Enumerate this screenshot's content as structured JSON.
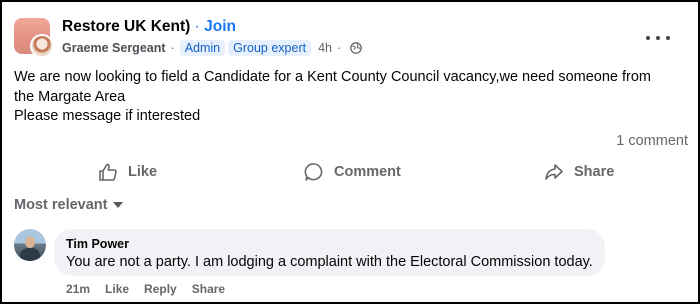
{
  "post": {
    "group_name": "Restore UK Kent)",
    "separator": "·",
    "join_label": "Join",
    "author": "Graeme Sergeant",
    "badges": [
      "Admin",
      "Group expert"
    ],
    "time": "4h",
    "time_separator": "·",
    "text_lines": [
      "We are now looking to field a Candidate for a Kent County Council vacancy,we need someone from",
      "the Margate Area",
      "Please message if interested"
    ],
    "comment_count": "1 comment"
  },
  "actions": {
    "like": "Like",
    "comment": "Comment",
    "share": "Share"
  },
  "sort_label": "Most relevant",
  "comments": [
    {
      "name": "Tim Power",
      "text": "You are not a party. I am lodging a complaint with the Electoral Commission today.",
      "time": "21m",
      "like": "Like",
      "reply": "Reply",
      "share": "Share"
    }
  ],
  "colors": {
    "link_blue": "#1877f2",
    "badge_bg": "#e7f0fd",
    "muted_text": "#65676b",
    "comment_bubble": "#f0f2f5"
  },
  "icons": {
    "privacy": "globe-icon",
    "menu": "more-options-icon",
    "like": "thumbs-up-icon",
    "comment": "speech-bubble-icon",
    "share": "share-arrow-icon",
    "sort": "caret-down-icon"
  }
}
